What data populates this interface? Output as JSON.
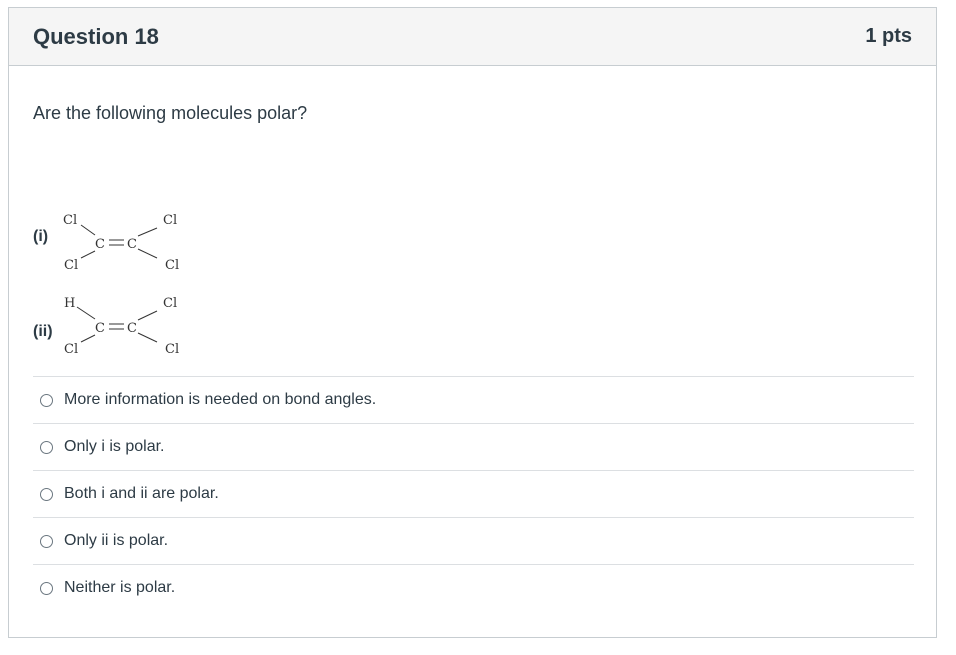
{
  "question": {
    "title": "Question 18",
    "points": "1 pts",
    "prompt": "Are the following molecules polar?"
  },
  "molecules": [
    {
      "label": "(i)",
      "top_left": "Cl",
      "bottom_left": "Cl",
      "top_right": "Cl",
      "bottom_right": "Cl",
      "left_carbon": "C",
      "right_carbon": "C"
    },
    {
      "label": "(ii)",
      "top_left": "H",
      "bottom_left": "Cl",
      "top_right": "Cl",
      "bottom_right": "Cl",
      "left_carbon": "C",
      "right_carbon": "C"
    }
  ],
  "answers": [
    {
      "label": "More information is needed on bond angles.",
      "selected": false
    },
    {
      "label": "Only i is polar.",
      "selected": false
    },
    {
      "label": "Both i and ii are polar.",
      "selected": false
    },
    {
      "label": "Only ii is polar.",
      "selected": false
    },
    {
      "label": "Neither is polar.",
      "selected": false
    }
  ]
}
